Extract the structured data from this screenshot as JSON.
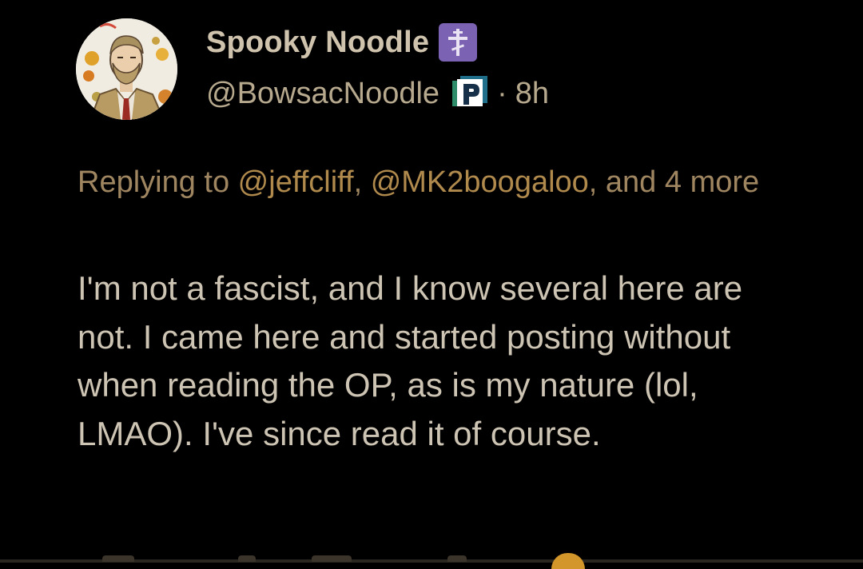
{
  "post": {
    "author": {
      "display_name": "Spooky Noodle",
      "handle": "@BowsacNoodle",
      "badge_icon": "orthodox-cross-icon",
      "badge_color": "#7b62b3",
      "handle_badge_icon": "p-badge-icon"
    },
    "separator": "·",
    "time": "8h",
    "reply": {
      "prefix": "Replying to ",
      "mentions": [
        "@jeffcliff",
        "@MK2boogaloo"
      ],
      "comma": ", ",
      "suffix": ", and 4 more"
    },
    "body": "I'm not a fascist, and I know several here are not. I came here and started posting without when reading the OP, as is my nature (lol, LMAO). I've since read it of course."
  },
  "colors": {
    "background": "#000000",
    "name": "#cfc3ad",
    "handle": "#b7a98e",
    "mention": "#b08a4d",
    "body": "#cdc4b3",
    "accent": "#d3962a"
  }
}
